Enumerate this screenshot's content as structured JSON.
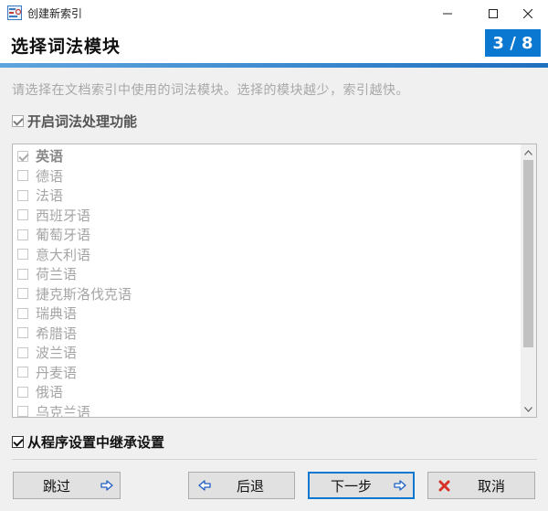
{
  "window": {
    "title": "创建新索引",
    "minimize_icon": "minimize-icon",
    "maximize_icon": "maximize-icon",
    "close_icon": "close-icon"
  },
  "header": {
    "title": "选择词法模块",
    "step": "3 / 8",
    "accent_color": "#0a78d0"
  },
  "instruction": "请选择在文档索引中使用的词法模块。选择的模块越少，索引越快。",
  "enable_lexical": {
    "label": "开启词法处理功能",
    "checked": true,
    "enabled": false
  },
  "languages": [
    {
      "label": "英语",
      "checked": true
    },
    {
      "label": "德语",
      "checked": false
    },
    {
      "label": "法语",
      "checked": false
    },
    {
      "label": "西班牙语",
      "checked": false
    },
    {
      "label": "葡萄牙语",
      "checked": false
    },
    {
      "label": "意大利语",
      "checked": false
    },
    {
      "label": "荷兰语",
      "checked": false
    },
    {
      "label": "捷克斯洛伐克语",
      "checked": false
    },
    {
      "label": "瑞典语",
      "checked": false
    },
    {
      "label": "希腊语",
      "checked": false
    },
    {
      "label": "波兰语",
      "checked": false
    },
    {
      "label": "丹麦语",
      "checked": false
    },
    {
      "label": "俄语",
      "checked": false
    },
    {
      "label": "乌克兰语",
      "checked": false
    }
  ],
  "inherit": {
    "label": "从程序设置中继承设置",
    "checked": true
  },
  "buttons": {
    "skip": "跳过",
    "back": "后退",
    "next": "下一步",
    "cancel": "取消"
  }
}
